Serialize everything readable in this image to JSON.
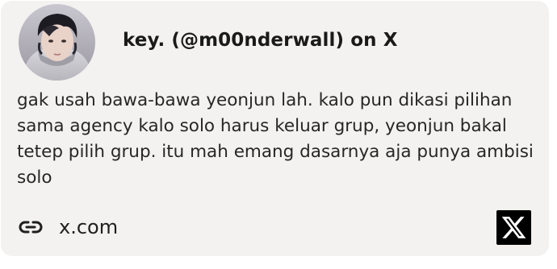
{
  "embed": {
    "title": "key. (@m00nderwall) on X",
    "text": "gak usah bawa-bawa yeonjun lah. kalo pun dikasi pilihan sama agency kalo solo harus keluar grup, yeonjun bakal tetep pilih grup. itu mah emang dasarnya aja punya ambisi solo",
    "domain": "x.com",
    "icons": {
      "avatar": "profile-photo",
      "link": "link-icon",
      "brand": "x-logo-icon"
    },
    "colors": {
      "card_background": "#f3f2f0",
      "text": "#262626",
      "logo_background": "#000000"
    }
  }
}
